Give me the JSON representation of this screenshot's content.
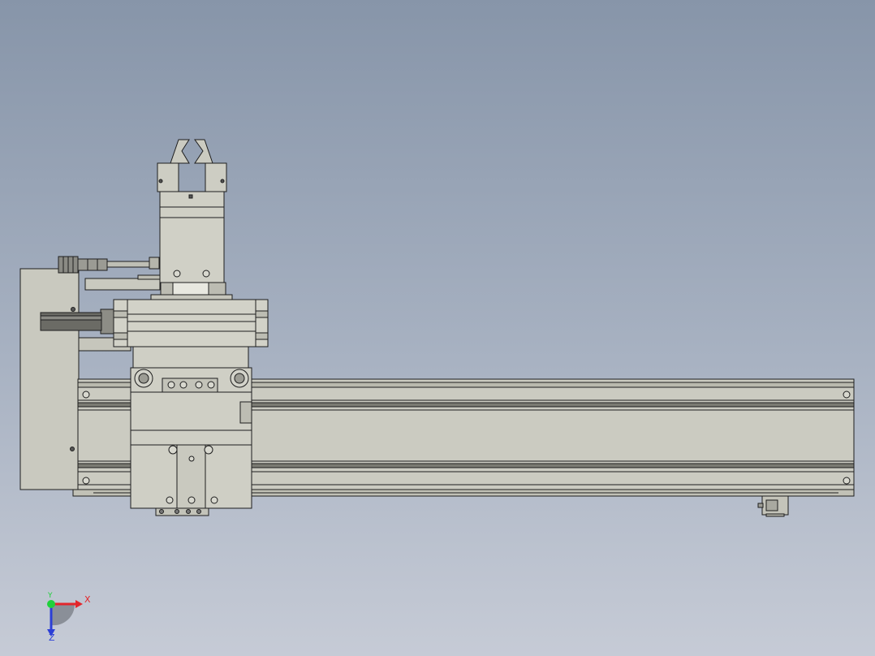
{
  "viewport": {
    "background_top": "#8795a9",
    "background_bottom": "#c6cbd6",
    "model_fill": "#cbcbc1",
    "model_edge": "#1e1e1e"
  },
  "triad": {
    "x_label": "X",
    "y_label": "Y",
    "z_label": "Z",
    "x_color": "#e3262b",
    "y_color": "#1fd13b",
    "z_color": "#2c3fd6"
  }
}
